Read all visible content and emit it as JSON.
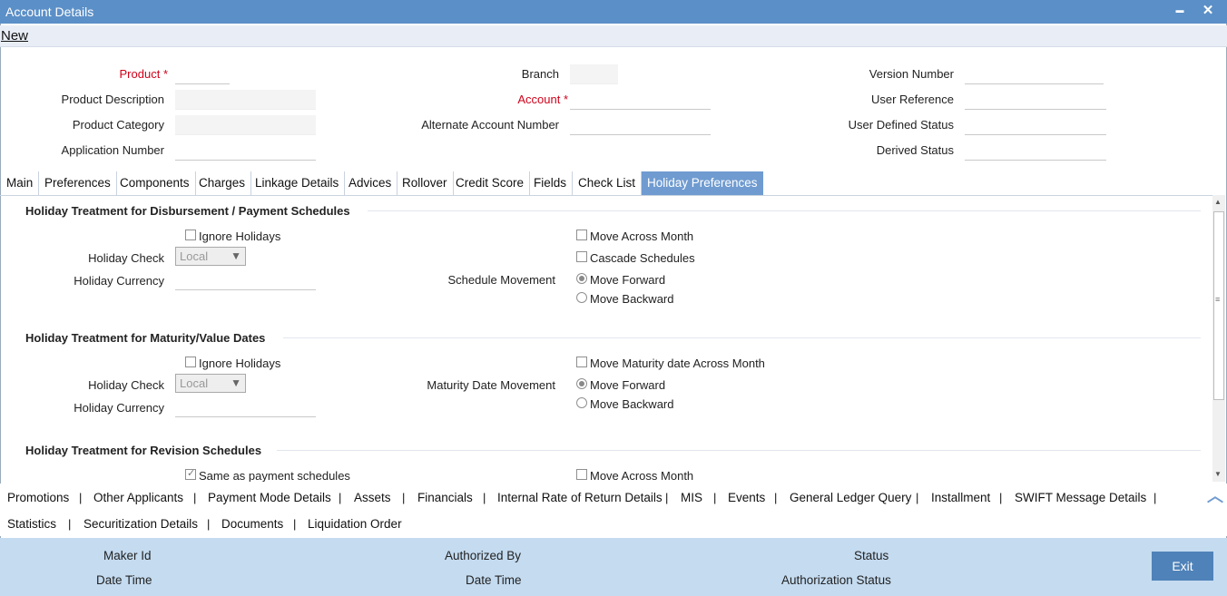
{
  "window": {
    "title": "Account Details",
    "minimize": "▬",
    "close": "✕"
  },
  "menu": {
    "new": "New"
  },
  "header": {
    "product": "Product",
    "product_description": "Product Description",
    "product_category": "Product Category",
    "application_number": "Application Number",
    "branch": "Branch",
    "account": "Account",
    "alternate_account_number": "Alternate Account Number",
    "version_number": "Version Number",
    "user_reference": "User Reference",
    "user_defined_status": "User Defined Status",
    "derived_status": "Derived Status"
  },
  "tabs": [
    "Main",
    "Preferences",
    "Components",
    "Charges",
    "Linkage Details",
    "Advices",
    "Rollover",
    "Credit Score",
    "Fields",
    "Check List",
    "Holiday Preferences"
  ],
  "sections": {
    "disbursement": {
      "title": "Holiday Treatment for Disbursement / Payment Schedules",
      "ignore_holidays": "Ignore Holidays",
      "holiday_check": "Holiday Check",
      "holiday_check_value": "Local",
      "holiday_currency": "Holiday Currency",
      "move_across_month": "Move Across Month",
      "cascade_schedules": "Cascade Schedules",
      "schedule_movement": "Schedule Movement",
      "move_forward": "Move Forward",
      "move_backward": "Move Backward"
    },
    "maturity": {
      "title": "Holiday Treatment for Maturity/Value Dates",
      "ignore_holidays": "Ignore Holidays",
      "holiday_check": "Holiday Check",
      "holiday_check_value": "Local",
      "holiday_currency": "Holiday Currency",
      "move_maturity_across_month": "Move Maturity date Across Month",
      "maturity_date_movement": "Maturity Date Movement",
      "move_forward": "Move Forward",
      "move_backward": "Move Backward"
    },
    "revision": {
      "title": "Holiday Treatment for Revision Schedules",
      "same_as_payment": "Same as payment schedules",
      "move_across_month": "Move Across Month"
    }
  },
  "links_row1": [
    "Promotions",
    "Other Applicants",
    "Payment Mode Details",
    "Assets",
    "Financials",
    "Internal Rate of Return Details",
    "MIS",
    "Events",
    "General Ledger Query",
    "Installment",
    "SWIFT Message Details"
  ],
  "links_row2": [
    "Statistics",
    "Securitization Details",
    "Documents",
    "Liquidation Order"
  ],
  "separator": "|",
  "footer": {
    "maker_id": "Maker Id",
    "date_time_1": "Date Time",
    "authorized_by": "Authorized By",
    "date_time_2": "Date Time",
    "status": "Status",
    "authorization_status": "Authorization Status",
    "exit": "Exit"
  },
  "colors": {
    "titlebar": "#5b8fc7",
    "active_tab": "#6f9bd0",
    "footer": "#c4dbf0",
    "exit_button": "#4f82b8",
    "required": "#d0021b"
  }
}
